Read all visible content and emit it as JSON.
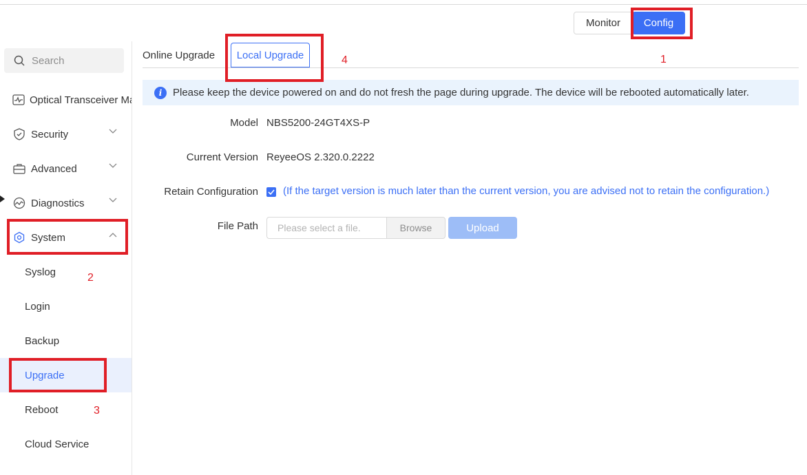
{
  "header": {
    "monitor_label": "Monitor",
    "config_label": "Config"
  },
  "sidebar": {
    "search_placeholder": "Search",
    "items": [
      {
        "label": "Optical Transceiver Ma",
        "icon": "pulse-icon"
      },
      {
        "label": "Security",
        "icon": "shield-icon"
      },
      {
        "label": "Advanced",
        "icon": "toolbox-icon"
      },
      {
        "label": "Diagnostics",
        "icon": "diagnostics-icon"
      },
      {
        "label": "System",
        "icon": "system-hex-icon"
      }
    ],
    "sub_items": [
      "Syslog",
      "Login",
      "Backup",
      "Upgrade",
      "Reboot",
      "Cloud Service"
    ],
    "active_sub_item": "Upgrade"
  },
  "tabs": {
    "online": "Online Upgrade",
    "local": "Local Upgrade",
    "active": "Local Upgrade"
  },
  "banner": {
    "text": "Please keep the device powered on and do not fresh the page during upgrade. The device will be rebooted automatically later."
  },
  "form": {
    "model_label": "Model",
    "model_value": "NBS5200-24GT4XS-P",
    "version_label": "Current Version",
    "version_value": "ReyeeOS 2.320.0.2222",
    "retain_label": "Retain Configuration",
    "retain_checked": true,
    "retain_note": "(If the target version is much later than the current version, you are advised not to retain the configuration.)",
    "file_path_label": "File Path",
    "file_placeholder": "Please select a file.",
    "browse_label": "Browse",
    "upload_label": "Upload"
  },
  "annotations": [
    "1",
    "2",
    "3",
    "4"
  ],
  "colors": {
    "accent": "#3b6ff5",
    "annotation_red": "#e01e26",
    "active_bg": "#eaf0fd",
    "banner_bg": "#eaf3fd",
    "upload_disabled": "#9dbdf7"
  }
}
